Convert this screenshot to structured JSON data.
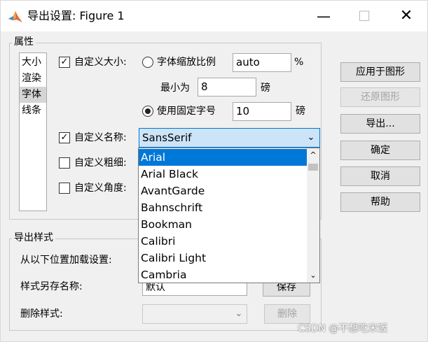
{
  "window": {
    "title": "导出设置: Figure 1",
    "minimize_symbol": "—",
    "maximize_symbol": "☐",
    "close_symbol": "✕"
  },
  "properties": {
    "group_label": "属性",
    "list": [
      {
        "label": "大小",
        "selected": false
      },
      {
        "label": "渲染",
        "selected": false
      },
      {
        "label": "字体",
        "selected": true
      },
      {
        "label": "线条",
        "selected": false
      }
    ],
    "custom_size": {
      "label": "自定义大小:",
      "checked": true
    },
    "font_scale": {
      "label": "字体缩放比例",
      "value": "auto",
      "unit": "%",
      "selected": false
    },
    "minimum": {
      "label": "最小为",
      "value": "8",
      "unit": "磅"
    },
    "fixed_size": {
      "label": "使用固定字号",
      "value": "10",
      "unit": "磅",
      "selected": true
    },
    "custom_name": {
      "label": "自定义名称:",
      "checked": true,
      "value": "SansSerif"
    },
    "custom_weight": {
      "label": "自定义粗细:",
      "checked": false
    },
    "custom_angle": {
      "label": "自定义角度:",
      "checked": false
    },
    "check_mark": "✓",
    "combo_arrow": "⌄"
  },
  "font_dropdown": {
    "options": [
      "Arial",
      "Arial Black",
      "AvantGarde",
      "Bahnschrift",
      "Bookman",
      "Calibri",
      "Calibri Light",
      "Cambria"
    ],
    "selected_index": 0,
    "scroll_up": "^",
    "scroll_down": "⌄"
  },
  "buttons": {
    "apply": "应用于图形",
    "restore": "还原图形",
    "export": "导出...",
    "ok": "确定",
    "cancel": "取消",
    "help": "帮助"
  },
  "export_style": {
    "group_label": "导出样式",
    "load_label": "从以下位置加载设置:",
    "save_as_label": "样式另存名称:",
    "save_as_value": "默认",
    "save_button": "保存",
    "delete_label": "删除样式:",
    "delete_button": "删除"
  },
  "watermark": "CSDN @不想吃米饭",
  "colors": {
    "accent": "#0078d7",
    "combo_bg": "#cce4f7",
    "window_bg": "#f0f0f0"
  }
}
